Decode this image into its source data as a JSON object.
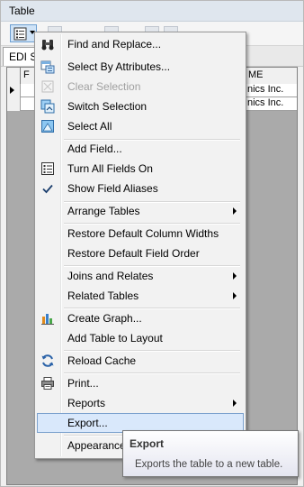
{
  "window": {
    "title": "Table"
  },
  "tab": {
    "label": "EDI Se"
  },
  "table": {
    "headers": [
      "F",
      "ME"
    ],
    "rows": [
      {
        "cells": [
          "",
          "nics Inc."
        ]
      },
      {
        "cells": [
          "",
          "nics Inc."
        ]
      }
    ]
  },
  "menu": {
    "items": [
      {
        "label": "Find and Replace...",
        "icon": "binoculars-icon"
      },
      {
        "label": "Select By Attributes...",
        "icon": "select-by-attributes-icon"
      },
      {
        "label": "Clear Selection",
        "icon": "clear-selection-icon",
        "disabled": true
      },
      {
        "label": "Switch Selection",
        "icon": "switch-selection-icon"
      },
      {
        "label": "Select All",
        "icon": "select-all-icon"
      },
      {
        "label": "Add Field...",
        "icon": ""
      },
      {
        "label": "Turn All Fields On",
        "icon": "fields-list-icon"
      },
      {
        "label": "Show Field Aliases",
        "icon": "checkmark-icon",
        "checked": true
      },
      {
        "label": "Arrange Tables",
        "submenu": true
      },
      {
        "label": "Restore Default Column Widths"
      },
      {
        "label": "Restore Default Field Order"
      },
      {
        "label": "Joins and Relates",
        "submenu": true
      },
      {
        "label": "Related Tables",
        "submenu": true
      },
      {
        "label": "Create Graph...",
        "icon": "bar-graph-icon"
      },
      {
        "label": "Add Table to Layout"
      },
      {
        "label": "Reload Cache",
        "icon": "reload-icon"
      },
      {
        "label": "Print...",
        "icon": "printer-icon"
      },
      {
        "label": "Reports",
        "submenu": true
      },
      {
        "label": "Export...",
        "highlighted": true
      },
      {
        "label": "Appearance"
      }
    ]
  },
  "tooltip": {
    "title": "Export",
    "body": "Exports the table to a new table."
  },
  "colors": {
    "highlight_fill": "#d9e8fb",
    "highlight_border": "#7da2ce",
    "disabled_text": "#a0a0a0",
    "menu_background": "#f2f2f2"
  }
}
